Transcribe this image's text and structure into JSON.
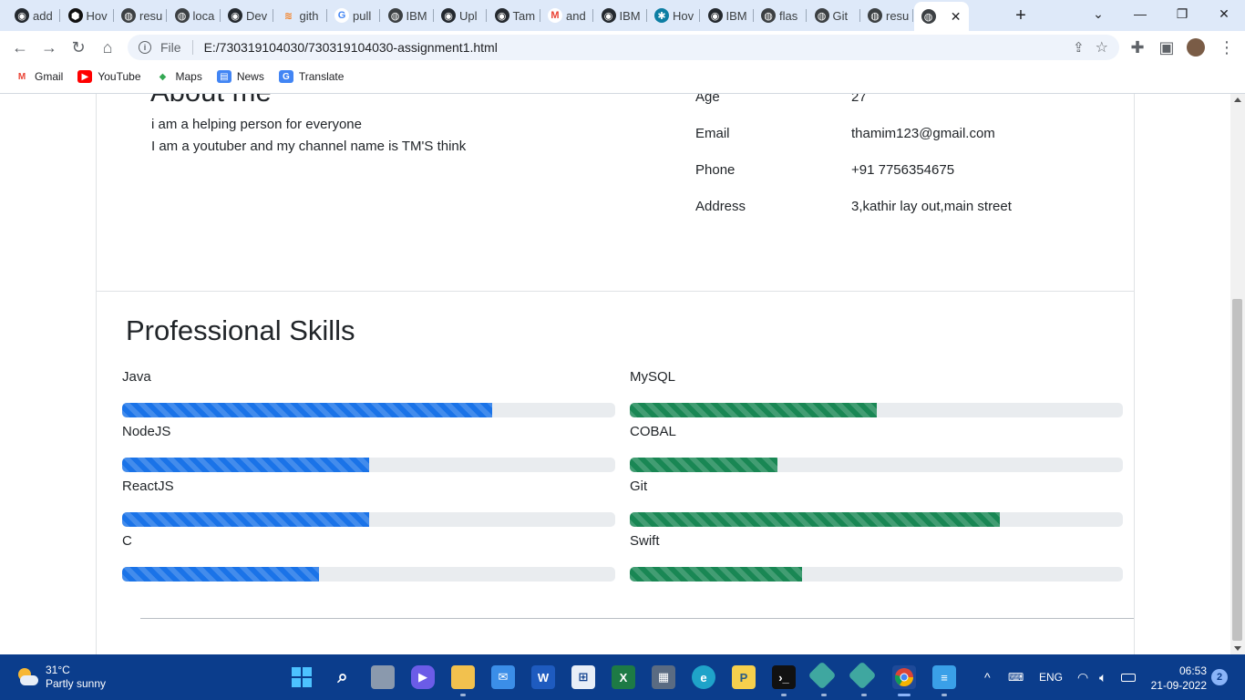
{
  "browser": {
    "tabs": [
      {
        "label": "add",
        "icon": "github-icon"
      },
      {
        "label": "Hov",
        "icon": "hexagon-icon"
      },
      {
        "label": "resu",
        "icon": "globe-icon"
      },
      {
        "label": "loca",
        "icon": "globe-icon"
      },
      {
        "label": "Dev",
        "icon": "github-icon"
      },
      {
        "label": "gith",
        "icon": "stackoverflow-icon"
      },
      {
        "label": "pull",
        "icon": "google-icon"
      },
      {
        "label": "IBM",
        "icon": "globe-icon"
      },
      {
        "label": "Upl",
        "icon": "github-icon"
      },
      {
        "label": "Tam",
        "icon": "github-icon"
      },
      {
        "label": "and",
        "icon": "gmail-icon"
      },
      {
        "label": "IBM",
        "icon": "github-icon"
      },
      {
        "label": "Hov",
        "icon": "snowflake-icon"
      },
      {
        "label": "IBM",
        "icon": "github-icon"
      },
      {
        "label": "flas",
        "icon": "globe-icon"
      },
      {
        "label": "Git",
        "icon": "globe-icon"
      },
      {
        "label": "resu",
        "icon": "globe-icon"
      },
      {
        "label": "",
        "icon": "globe-icon",
        "active": true
      }
    ],
    "address": {
      "scheme": "File",
      "url": "E:/730319104030/730319104030-assignment1.html"
    },
    "bookmarks": [
      {
        "label": "Gmail",
        "icon": "gmail-icon"
      },
      {
        "label": "YouTube",
        "icon": "youtube-icon"
      },
      {
        "label": "Maps",
        "icon": "maps-icon"
      },
      {
        "label": "News",
        "icon": "news-icon"
      },
      {
        "label": "Translate",
        "icon": "translate-icon"
      }
    ]
  },
  "about": {
    "title": "About me",
    "lines": [
      "i am a helping person for everyone",
      "I am a youtuber and my channel name is TM'S think"
    ]
  },
  "details": [
    {
      "label": "Age",
      "value": "27"
    },
    {
      "label": "Email",
      "value": "thamim123@gmail.com"
    },
    {
      "label": "Phone",
      "value": "+91 7756354675"
    },
    {
      "label": "Address",
      "value": "3,kathir lay out,main street"
    }
  ],
  "skills": {
    "title": "Professional Skills",
    "colors": {
      "left": "#1a73e8",
      "right": "#198754"
    },
    "left": [
      {
        "name": "Java",
        "percent": 75
      },
      {
        "name": "NodeJS",
        "percent": 50
      },
      {
        "name": "ReactJS",
        "percent": 50
      },
      {
        "name": "C",
        "percent": 40
      }
    ],
    "right": [
      {
        "name": "MySQL",
        "percent": 50
      },
      {
        "name": "COBAL",
        "percent": 30
      },
      {
        "name": "Git",
        "percent": 75
      },
      {
        "name": "Swift",
        "percent": 35
      }
    ]
  },
  "taskbar": {
    "weather": {
      "temp": "31°C",
      "condition": "Partly sunny"
    },
    "language": "ENG",
    "time": "06:53",
    "date": "21-09-2022",
    "notifications": "2"
  }
}
